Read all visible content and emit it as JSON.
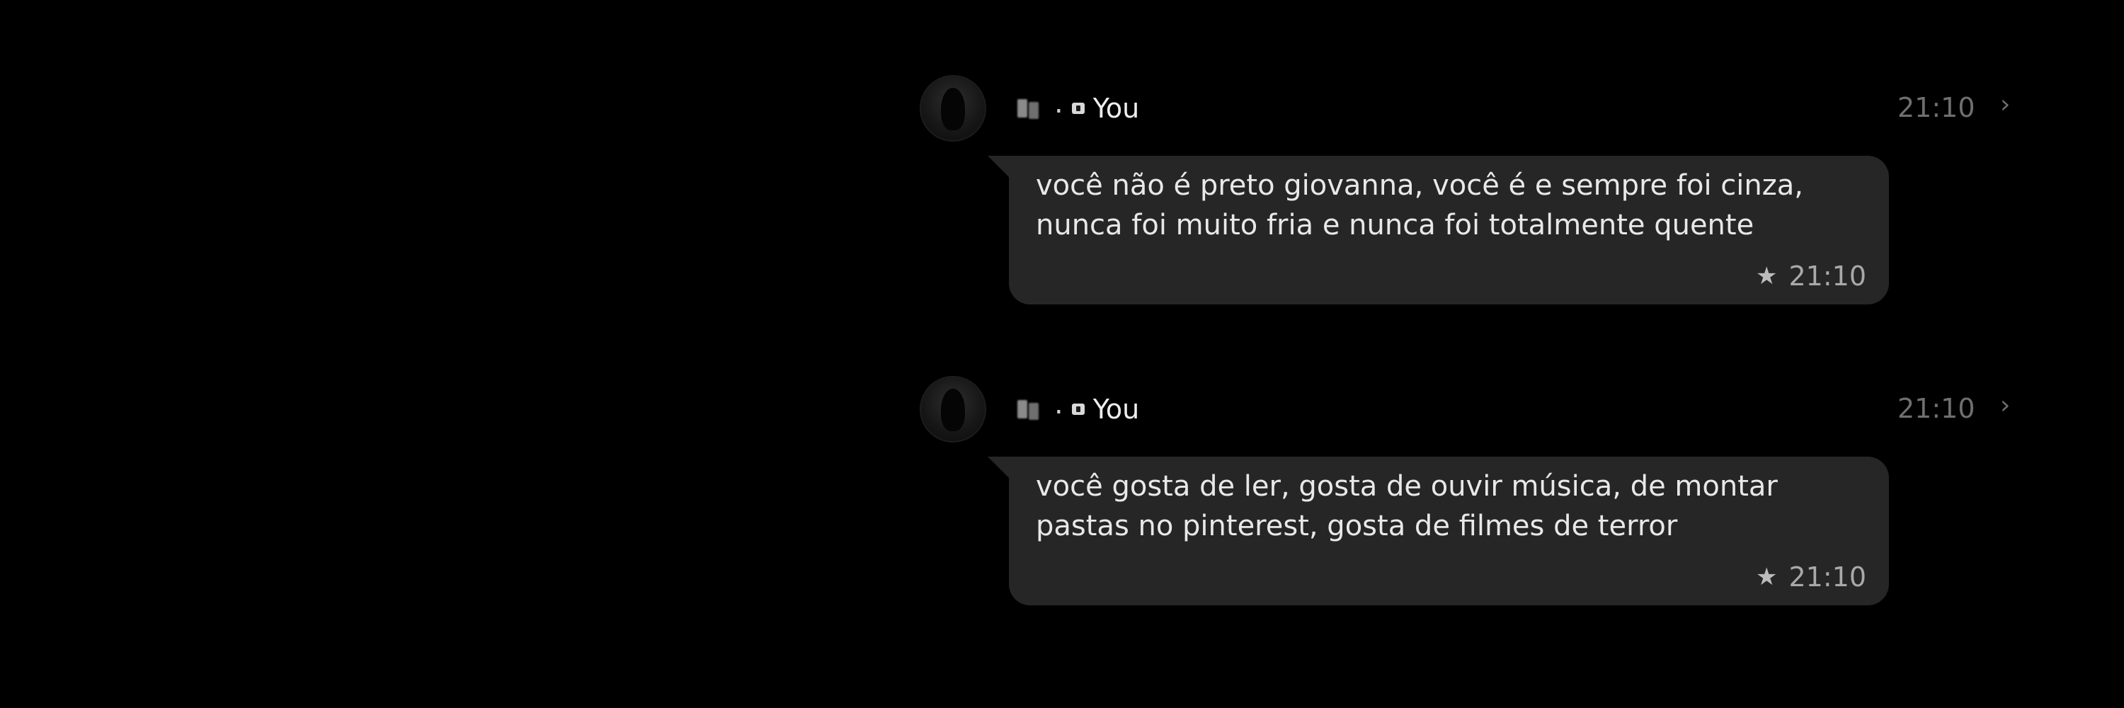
{
  "messages": [
    {
      "sender": "You",
      "sender_separator": ".",
      "header_time": "21:10",
      "text": "você não é preto giovanna, você é e sempre foi cinza, nunca foi muito fria e nunca foi totalmente quente",
      "time": "21:10",
      "icons": {
        "avatar": "profile-avatar",
        "sender": "blurred-name",
        "indicator": "device-icon",
        "star": "star-icon",
        "chevron": "chevron-right-icon"
      }
    },
    {
      "sender": "You",
      "sender_separator": ".",
      "header_time": "21:10",
      "text": "você gosta de ler, gosta de ouvir música, de montar pastas no pinterest, gosta de filmes de terror",
      "time": "21:10",
      "icons": {
        "avatar": "profile-avatar",
        "sender": "blurred-name",
        "indicator": "device-icon",
        "star": "star-icon",
        "chevron": "chevron-right-icon"
      }
    }
  ],
  "colors": {
    "background": "#000000",
    "bubble": "#262626",
    "text": "#e8e8e8",
    "muted": "#6f6f6f"
  }
}
